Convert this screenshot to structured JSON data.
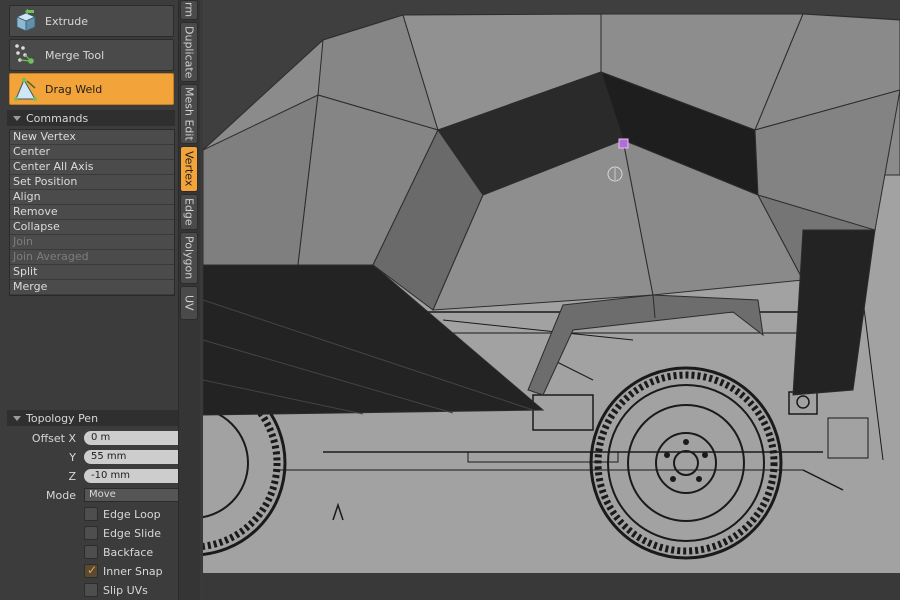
{
  "toolbar": {
    "tools": [
      {
        "label": "Extrude",
        "icon": "extrude-icon",
        "active": false
      },
      {
        "label": "Merge Tool",
        "icon": "merge-tool-icon",
        "active": false
      },
      {
        "label": "Drag Weld",
        "icon": "drag-weld-icon",
        "active": true
      }
    ]
  },
  "commands": {
    "header": "Commands",
    "items": [
      {
        "label": "New Vertex",
        "enabled": true
      },
      {
        "label": "Center",
        "enabled": true
      },
      {
        "label": "Center All Axis",
        "enabled": true
      },
      {
        "label": "Set Position",
        "enabled": true
      },
      {
        "label": "Align",
        "enabled": true
      },
      {
        "label": "Remove",
        "enabled": true
      },
      {
        "label": "Collapse",
        "enabled": true
      },
      {
        "label": "Join",
        "enabled": false
      },
      {
        "label": "Join Averaged",
        "enabled": false
      },
      {
        "label": "Split",
        "enabled": true
      },
      {
        "label": "Merge",
        "enabled": true
      }
    ]
  },
  "side_tabs": [
    {
      "label": "rm",
      "active": false
    },
    {
      "label": "Duplicate",
      "active": false
    },
    {
      "label": "Mesh Edit",
      "active": false
    },
    {
      "label": "Vertex",
      "active": true
    },
    {
      "label": "Edge",
      "active": false
    },
    {
      "label": "Polygon",
      "active": false
    },
    {
      "label": "UV",
      "active": false
    }
  ],
  "topology_pen": {
    "header": "Topology Pen",
    "offset_x_label": "Offset X",
    "offset_x": "0 m",
    "y_label": "Y",
    "y": "55 mm",
    "z_label": "Z",
    "z": "-10 mm",
    "mode_label": "Mode",
    "mode": "Move",
    "options": [
      {
        "label": "Edge Loop",
        "checked": false
      },
      {
        "label": "Edge Slide",
        "checked": false
      },
      {
        "label": "Backface",
        "checked": false
      },
      {
        "label": "Inner Snap",
        "checked": true
      },
      {
        "label": "Slip UVs",
        "checked": false
      }
    ]
  },
  "colors": {
    "accent": "#f2a33a",
    "panel": "#3c3c3c",
    "button": "#4a4a4a",
    "reference_bg": "#a2a2a2",
    "mesh_light": "#888888",
    "mesh_dark": "#232323",
    "selection": "#b56bd6"
  }
}
